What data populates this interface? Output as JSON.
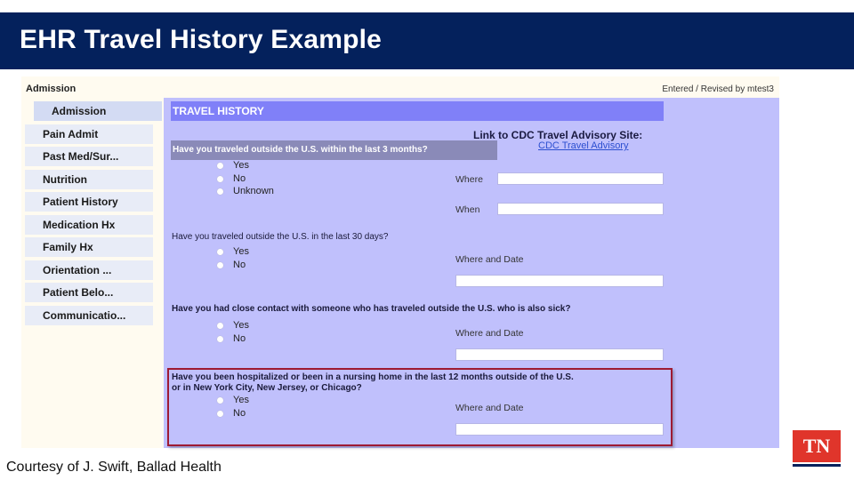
{
  "slide": {
    "title": "EHR Travel History Example",
    "courtesy": "Courtesy of J. Swift, Ballad Health",
    "logo_text": "TN",
    "colors": {
      "title_bar": "#04215c",
      "logo_red": "#e0352b",
      "highlight_border": "#9e1b32",
      "form_background": "#c0c0fc",
      "section_header": "#8080f8"
    }
  },
  "ehr": {
    "header_label": "Admission",
    "entered_by": "Entered / Revised by  mtest3",
    "sidebar": {
      "items": [
        {
          "label": "Admission",
          "active": true
        },
        {
          "label": "Pain Admit",
          "active": false
        },
        {
          "label": "Past Med/Sur...",
          "active": false
        },
        {
          "label": "Nutrition",
          "active": false
        },
        {
          "label": "Patient History",
          "active": false
        },
        {
          "label": "Medication Hx",
          "active": false
        },
        {
          "label": "Family Hx",
          "active": false
        },
        {
          "label": "Orientation ...",
          "active": false
        },
        {
          "label": "Patient Belo...",
          "active": false
        },
        {
          "label": "Communicatio...",
          "active": false
        }
      ]
    },
    "section_title": "TRAVEL HISTORY",
    "cdc": {
      "label": "Link to CDC Travel Advisory Site:",
      "link_text": "CDC Travel Advisory"
    },
    "questions": [
      {
        "text": "Have you traveled outside the U.S. within the last 3 months?",
        "options": [
          "Yes",
          "No",
          "Unknown"
        ],
        "fields": [
          {
            "label": "Where",
            "value": ""
          },
          {
            "label": "When",
            "value": ""
          }
        ]
      },
      {
        "text": "Have you traveled outside the U.S. in the last 30 days?",
        "options": [
          "Yes",
          "No"
        ],
        "fields": [
          {
            "label": "Where and Date",
            "value": ""
          }
        ]
      },
      {
        "text": "Have you had close contact with someone who has traveled outside the U.S. who is also sick?",
        "options": [
          "Yes",
          "No"
        ],
        "fields": [
          {
            "label": "Where and Date",
            "value": ""
          }
        ]
      },
      {
        "text_line1": "Have you been hospitalized or been in a nursing home in the last 12 months outside of the U.S.",
        "text_line2": "or in New York City, New Jersey, or Chicago?",
        "options": [
          "Yes",
          "No"
        ],
        "fields": [
          {
            "label": "Where and Date",
            "value": ""
          }
        ],
        "highlighted": true
      }
    ]
  }
}
